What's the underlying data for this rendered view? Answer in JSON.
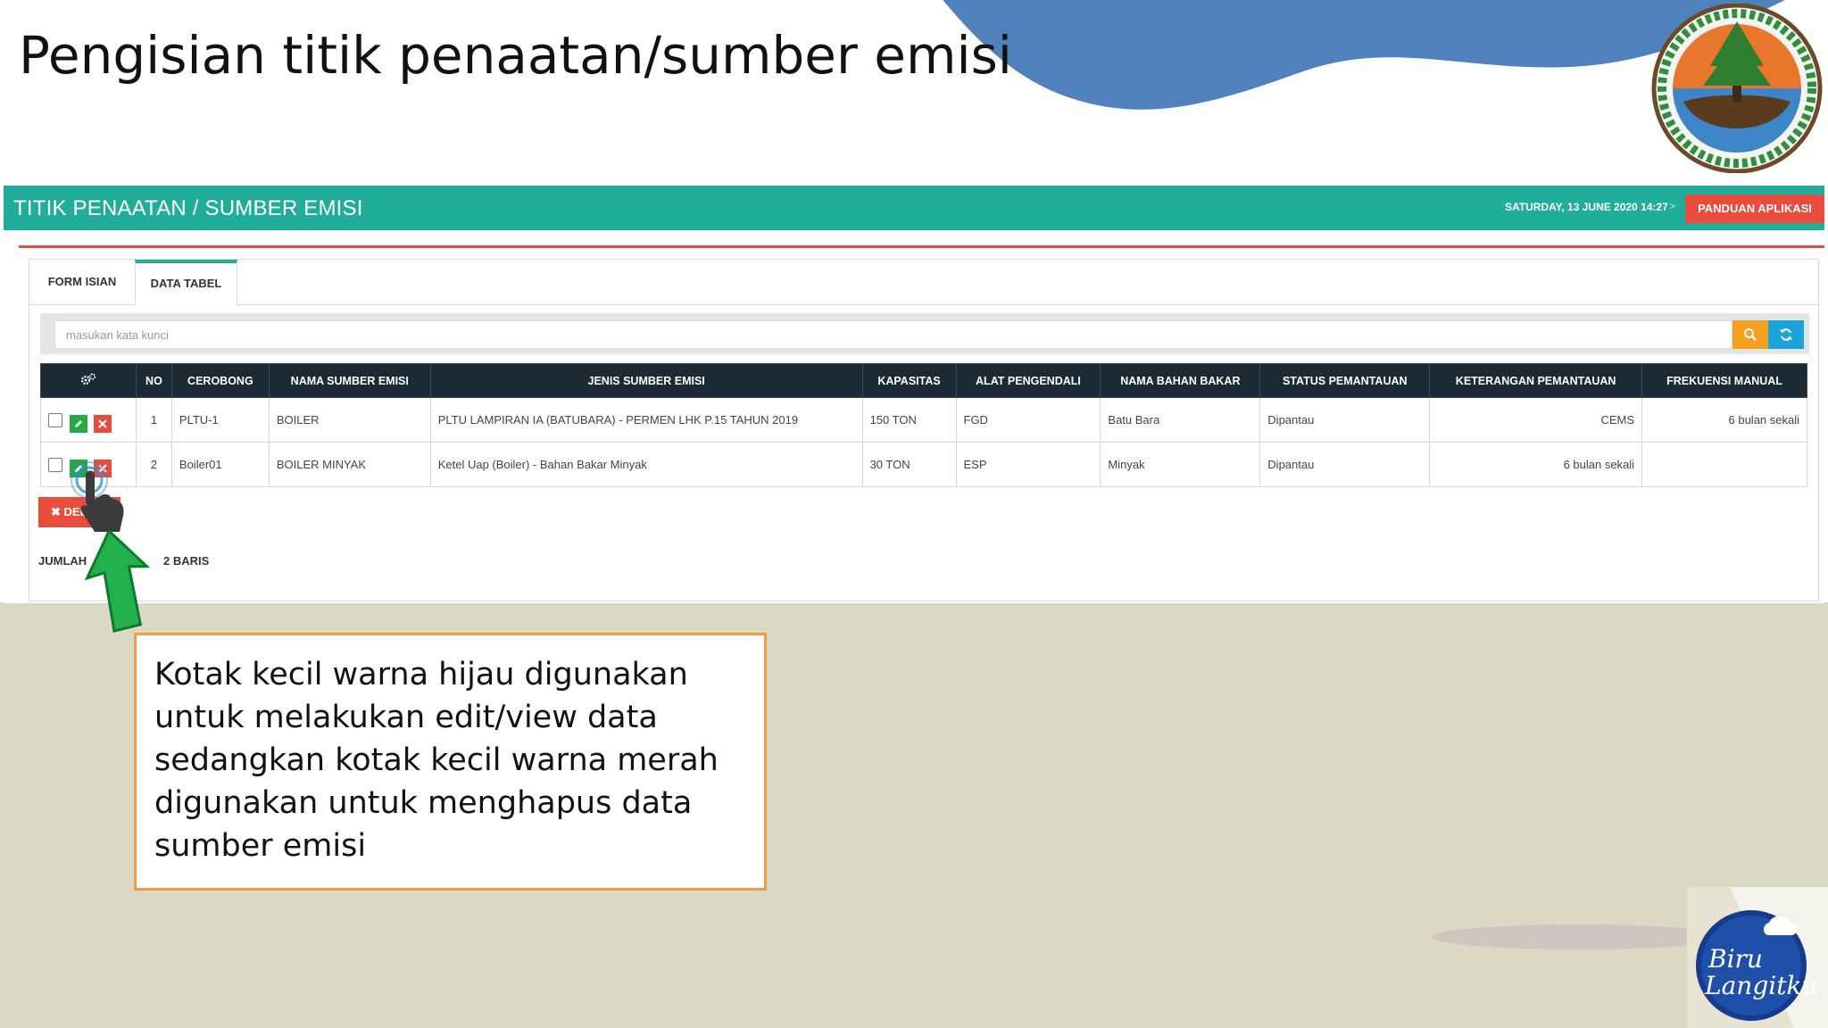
{
  "slide": {
    "title": "Pengisian titik penaatan/sumber emisi",
    "callout_text": "Kotak kecil warna hijau digunakan untuk melakukan edit/view data sedangkan kotak kecil warna merah digunakan untuk menghapus data sumber emisi",
    "logos": [
      "klhk-logo",
      "biru-langitku-logo"
    ],
    "logo_text": "Biru Langitku"
  },
  "app": {
    "title": "TITIK PENAATAN / SUMBER EMISI",
    "datetime": "SATURDAY, 13 JUNE 2020 14:27",
    "datetime_sep": ">",
    "panduan_label": "PANDUAN APLIKASI",
    "tabs": [
      {
        "label": "FORM ISIAN",
        "active": false
      },
      {
        "label": "DATA TABEL",
        "active": true
      }
    ],
    "search": {
      "placeholder": "masukan kata kunci",
      "value": ""
    },
    "table": {
      "headers": [
        "NO",
        "CEROBONG",
        "NAMA SUMBER EMISI",
        "JENIS SUMBER EMISI",
        "KAPASITAS",
        "ALAT PENGENDALI",
        "NAMA BAHAN BAKAR",
        "STATUS PEMANTAUAN",
        "KETERANGAN PEMANTAUAN",
        "FREKUENSI MANUAL"
      ],
      "rows": [
        {
          "no": "1",
          "cerobong": "PLTU-1",
          "nama": "BOILER",
          "jenis": "PLTU LAMPIRAN IA (BATUBARA) - PERMEN LHK P.15 TAHUN 2019",
          "kapasitas": "150 TON",
          "alat": "FGD",
          "bahan": "Batu Bara",
          "status": "Dipantau",
          "keterangan": "CEMS",
          "frekuensi": "6 bulan sekali"
        },
        {
          "no": "2",
          "cerobong": "Boiler01",
          "nama": "BOILER MINYAK",
          "jenis": "Ketel Uap (Boiler) - Bahan Bakar Minyak",
          "kapasitas": "30 TON",
          "alat": "ESP",
          "bahan": "Minyak",
          "status": "Dipantau",
          "keterangan": "6 bulan sekali",
          "frekuensi": ""
        }
      ]
    },
    "delete_label": "✖ DEL",
    "jumlah_label": "JUMLAH",
    "jumlah_suffix": "2 BARIS"
  },
  "colors": {
    "header_teal": "#20ad99",
    "accent_red": "#e74c3c",
    "table_header": "#1e2a33",
    "blob_blue": "#4f81bd",
    "slide_lower": "#dcd9c2",
    "callout_border": "#f39a4a"
  }
}
